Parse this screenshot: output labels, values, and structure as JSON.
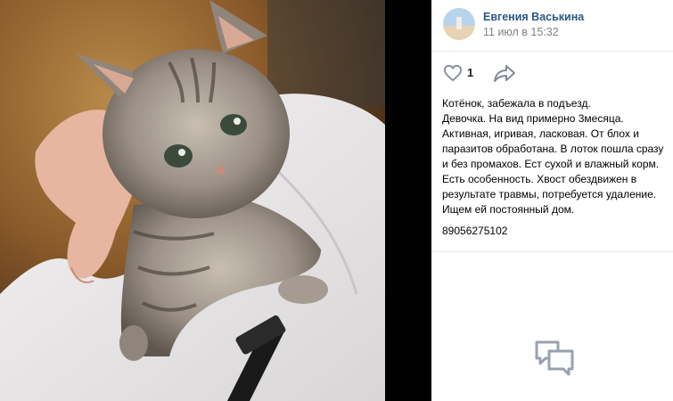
{
  "author": {
    "name": "Евгения Васькина",
    "date": "11 июл в 15:32"
  },
  "actions": {
    "likes": "1",
    "like_icon": "heart-icon",
    "share_icon": "share-arrow-icon"
  },
  "post": {
    "text": "Котёнок, забежала в подъезд.\nДевочка. На вид примерно 3месяца.\nАктивная, игривая, ласковая. От блох и паразитов обработана. В лоток пошла сразу и без промахов. Ест сухой и влажный корм.\nЕсть особенность. Хвост обездвижен в результате травмы, потребуется удаление.\nИщем ей постоянный дом.",
    "phone": "89056275102"
  },
  "comments": {
    "icon": "comments-icon"
  },
  "colors": {
    "link": "#2a5885",
    "muted": "#828282",
    "divider": "#e7e8ec",
    "icon_gray": "#99a2ad"
  }
}
